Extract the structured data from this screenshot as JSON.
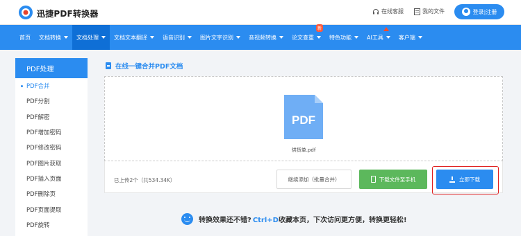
{
  "header": {
    "app_name": "迅捷PDF转换器",
    "support_label": "在线客服",
    "docs_label": "我的文件",
    "login_label": "登录|注册"
  },
  "nav": {
    "items": [
      {
        "label": "首页",
        "has_caret": false
      },
      {
        "label": "文档转换",
        "has_caret": true
      },
      {
        "label": "文档处理",
        "has_caret": true,
        "active": true
      },
      {
        "label": "文档文本翻译",
        "has_caret": true
      },
      {
        "label": "语音识别",
        "has_caret": true
      },
      {
        "label": "图片文字识别",
        "has_caret": true
      },
      {
        "label": "音视频转换",
        "has_caret": true
      },
      {
        "label": "论文查重",
        "has_caret": true,
        "badge": "新"
      },
      {
        "label": "特色功能",
        "has_caret": true
      },
      {
        "label": "AI工具",
        "has_caret": true
      },
      {
        "label": "客户端",
        "has_caret": true
      }
    ]
  },
  "sidebar": {
    "title": "PDF处理",
    "items": [
      {
        "label": "PDF合并",
        "active": true
      },
      {
        "label": "PDF分割"
      },
      {
        "label": "PDF解密"
      },
      {
        "label": "PDF增加密码"
      },
      {
        "label": "PDF修改密码"
      },
      {
        "label": "PDF图片获取"
      },
      {
        "label": "PDF插入页面"
      },
      {
        "label": "PDF删除页"
      },
      {
        "label": "PDF页面提取"
      },
      {
        "label": "PDF旋转"
      }
    ]
  },
  "main": {
    "section_title": "在线一键合并PDF文档",
    "file": {
      "icon_text": "PDF",
      "name": "供货单.pdf"
    },
    "upload_status": "已上传2个（共534.34K）",
    "continue_button": "继续添加（批量合并）",
    "phone_button": "下载文件至手机",
    "download_button": "立即下载"
  },
  "promo": {
    "text_before": "转换效果还不错?",
    "shortcut": "Ctrl+D",
    "text_after": "收藏本页，下次访问更方便，转换更轻松!"
  },
  "colors": {
    "primary": "#2b8cf0",
    "nav_active": "#0f6fd6",
    "green": "#5cb85c",
    "highlight": "#e02020",
    "badge": "#ff5a3c"
  }
}
